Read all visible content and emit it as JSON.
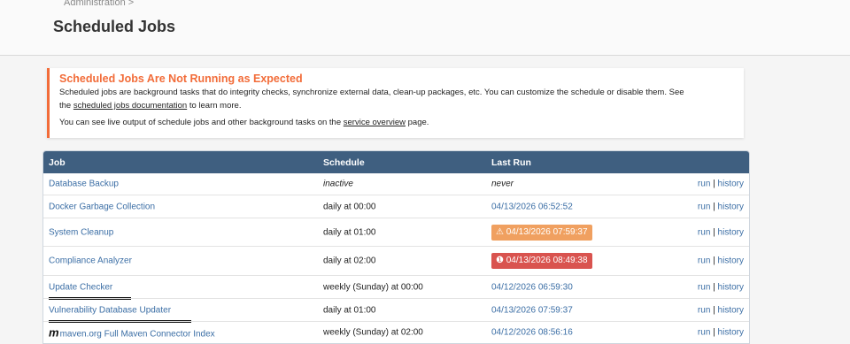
{
  "breadcrumb": "Administration >",
  "page_title": "Scheduled Jobs",
  "alert": {
    "title": "Scheduled Jobs Are Not Running as Expected",
    "line1_before": "Scheduled jobs are background tasks that do integrity checks, synchronize external data, clean-up packages, etc. You can customize the schedule or disable them. See",
    "line2_prefix": "the ",
    "doc_link": "scheduled jobs documentation",
    "line2_suffix": " to learn more.",
    "line3_prefix": "You can see live output of schedule jobs and other background tasks on the ",
    "service_link": "service overview",
    "line3_suffix": " page."
  },
  "table": {
    "headers": {
      "job": "Job",
      "schedule": "Schedule",
      "last_run": "Last Run"
    },
    "run_label": "run",
    "separator": "|",
    "history_label": "history",
    "rows": [
      {
        "job": "Database Backup",
        "schedule": "inactive",
        "last_run": "never"
      },
      {
        "job": "Docker Garbage Collection",
        "schedule": "daily at 00:00",
        "last_run": "04/13/2026 06:52:52"
      },
      {
        "job": "System Cleanup",
        "schedule": "daily at 01:00",
        "last_run": "04/13/2026 07:59:37",
        "status": "warning"
      },
      {
        "job": "Compliance Analyzer",
        "schedule": "daily at 02:00",
        "last_run": "04/13/2026 08:49:38",
        "status": "error"
      },
      {
        "job": "Update Checker",
        "schedule": "weekly (Sunday) at 00:00",
        "last_run": "04/12/2026 06:59:30"
      },
      {
        "job": "Vulnerability Database Updater",
        "schedule": "daily at 01:00",
        "last_run": "04/13/2026 07:59:37"
      },
      {
        "job_logo": "m",
        "job": "maven.org Full Maven Connector Index",
        "schedule": "weekly (Sunday) at 02:00",
        "last_run": "04/12/2026 08:56:16"
      }
    ]
  },
  "icons": {
    "warning": "warning-triangle-icon",
    "error": "error-circle-icon"
  },
  "colors": {
    "accent": "#f26c39",
    "header_bg": "#3f5f80",
    "link": "#3b6ea5",
    "warning": "#f0a060",
    "error": "#d9534f"
  }
}
